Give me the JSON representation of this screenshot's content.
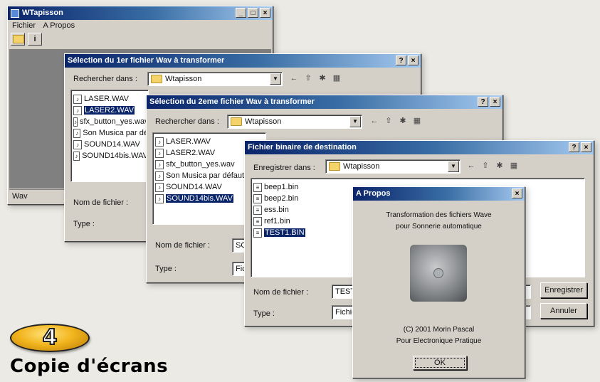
{
  "main_window": {
    "title": "WTapisson",
    "menu": [
      "Fichier",
      "A Propos"
    ],
    "status": "Wav"
  },
  "dialog1": {
    "title": "Sélection du 1er fichier Wav à transformer",
    "look_in_label": "Rechercher dans :",
    "folder": "Wtapisson",
    "files": [
      "LASER.WAV",
      "LASER2.WAV",
      "sfx_button_yes.wav",
      "Son Musica par dé",
      "SOUND14.WAV",
      "SOUND14bis.WAV"
    ],
    "selected_index": 1,
    "filename_label": "Nom de fichier :",
    "type_label": "Type :"
  },
  "dialog2": {
    "title": "Sélection du 2eme fichier Wav à transformer",
    "look_in_label": "Rechercher dans :",
    "folder": "Wtapisson",
    "files": [
      "LASER.WAV",
      "LASER2.WAV",
      "sfx_button_yes.wav",
      "Son Musica par défaut",
      "SOUND14.WAV",
      "SOUND14bis.WAV"
    ],
    "selected_index": 5,
    "filename_label": "Nom de fichier :",
    "filename_value": "SO",
    "type_label": "Type :",
    "type_value": "Fic"
  },
  "dialog3": {
    "title": "Fichier binaire de destination",
    "save_in_label": "Enregistrer dans :",
    "folder": "Wtapisson",
    "files": [
      "beep1.bin",
      "beep2.bin",
      "ess.bin",
      "ref1.bin",
      "TEST1.BIN"
    ],
    "selected_index": 4,
    "filename_label": "Nom de fichier :",
    "filename_value": "TEST",
    "type_label": "Type :",
    "type_value": "Fichie",
    "save_button": "Enregistrer",
    "cancel_button": "Annuler"
  },
  "about": {
    "title": "A Propos",
    "line1": "Transformation des fichiers Wave",
    "line2": "pour Sonnerie automatique",
    "credit1": "(C) 2001 Morin Pascal",
    "credit2": "Pour Electronique Pratique",
    "ok": "OK"
  },
  "badge": {
    "number": "4",
    "caption": "Copie d'écrans",
    "color": "#f2b51e"
  },
  "colors": {
    "titlebar": "#0a246a",
    "selection": "#0a246a",
    "window": "#d4d0c8"
  }
}
